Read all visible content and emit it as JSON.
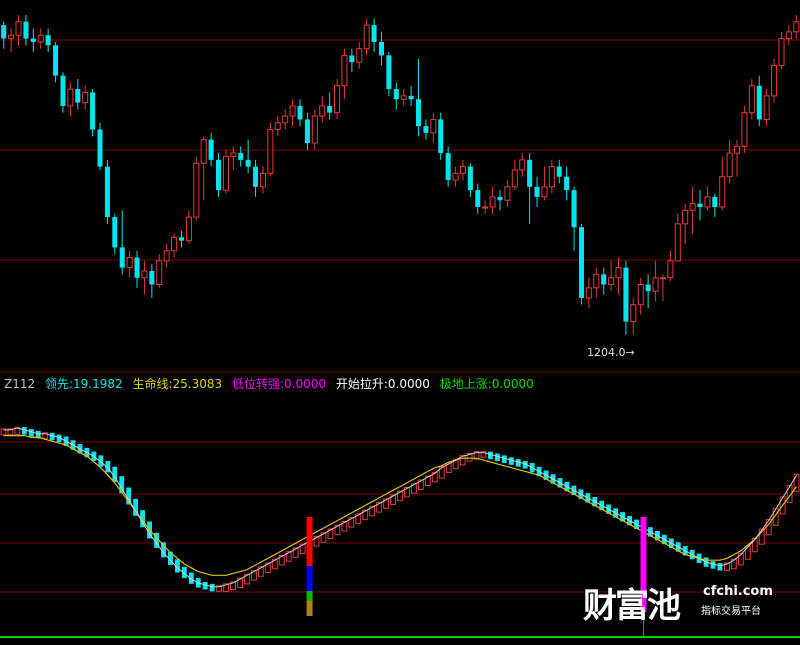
{
  "colors": {
    "background": "#000000",
    "up_candle": "#e8363a",
    "down_candle": "#00e5ee",
    "grid": "#7a0000",
    "yellow_line": "#d8c400",
    "white_line": "#d0d0d0",
    "bottom_line": "#00d000",
    "magenta_marker": "#ff00ff"
  },
  "legend": {
    "code": "Z112",
    "lead_label": "领先:19.1982",
    "life_label": "生命线:25.3083",
    "low_turn_label": "低位转强:0.0000",
    "start_rise_label": "开始拉升:0.0000",
    "bottom_rise_label": "极地上涨:0.0000",
    "code_color": "#c0c0c0",
    "lead_color": "#00e5ee",
    "life_color": "#e6d000",
    "low_turn_color": "#ff00ff",
    "start_rise_color": "#ffffff",
    "bottom_rise_color": "#00e000"
  },
  "price_annotation": "1204.0",
  "price_annotation_arrow": "→",
  "watermark": {
    "logo": "财富池",
    "site": "cfchi.com",
    "subtitle": "指标交易平台"
  },
  "chart_data": [
    {
      "type": "candlestick",
      "title": "",
      "note": "price panel; values in unscaled price units (no axis labels shown except the low annotation)",
      "min_price_label": 1204.0,
      "candles": [
        [
          100,
          96,
          101,
          93
        ],
        [
          96,
          97,
          99,
          92
        ],
        [
          97,
          101,
          103,
          94
        ],
        [
          101,
          96,
          103,
          94
        ],
        [
          96,
          95,
          99,
          92
        ],
        [
          95,
          97,
          99,
          93
        ],
        [
          97,
          94,
          99,
          92
        ],
        [
          94,
          85,
          95,
          83
        ],
        [
          85,
          76,
          86,
          74
        ],
        [
          76,
          81,
          83,
          73
        ],
        [
          81,
          77,
          84,
          75
        ],
        [
          77,
          80,
          82,
          75
        ],
        [
          80,
          69,
          81,
          67
        ],
        [
          69,
          58,
          71,
          57
        ],
        [
          58,
          43,
          60,
          41
        ],
        [
          43,
          34,
          44,
          32
        ],
        [
          34,
          28,
          45,
          26
        ],
        [
          28,
          31,
          33,
          25
        ],
        [
          31,
          25,
          33,
          22
        ],
        [
          25,
          27,
          30,
          20
        ],
        [
          27,
          23,
          29,
          19
        ],
        [
          23,
          30,
          32,
          22
        ],
        [
          30,
          33,
          35,
          28
        ],
        [
          33,
          37,
          38,
          31
        ],
        [
          37,
          36,
          39,
          34
        ],
        [
          36,
          43,
          45,
          35
        ],
        [
          43,
          59,
          61,
          42
        ],
        [
          59,
          66,
          67,
          48
        ],
        [
          66,
          60,
          68,
          58
        ],
        [
          60,
          51,
          62,
          49
        ],
        [
          51,
          61,
          63,
          50
        ],
        [
          61,
          62,
          64,
          57
        ],
        [
          62,
          60,
          64,
          58
        ],
        [
          60,
          58,
          66,
          56
        ],
        [
          58,
          52,
          60,
          49
        ],
        [
          52,
          56,
          58,
          50
        ],
        [
          56,
          69,
          71,
          55
        ],
        [
          69,
          71,
          73,
          67
        ],
        [
          71,
          73,
          75,
          69
        ],
        [
          73,
          76,
          78,
          70
        ],
        [
          76,
          72,
          78,
          70
        ],
        [
          72,
          65,
          74,
          63
        ],
        [
          65,
          73,
          75,
          63
        ],
        [
          73,
          76,
          79,
          71
        ],
        [
          76,
          74,
          80,
          72
        ],
        [
          74,
          82,
          84,
          72
        ],
        [
          82,
          91,
          93,
          78
        ],
        [
          91,
          89,
          93,
          86
        ],
        [
          89,
          93,
          95,
          87
        ],
        [
          93,
          100,
          102,
          91
        ],
        [
          100,
          95,
          102,
          92
        ],
        [
          95,
          91,
          98,
          88
        ],
        [
          91,
          81,
          92,
          79
        ],
        [
          81,
          78,
          83,
          75
        ],
        [
          78,
          79,
          81,
          76
        ],
        [
          79,
          78,
          82,
          76
        ],
        [
          78,
          70,
          90,
          67
        ],
        [
          70,
          68,
          72,
          66
        ],
        [
          68,
          72,
          74,
          65
        ],
        [
          72,
          62,
          74,
          60
        ],
        [
          62,
          54,
          64,
          52
        ],
        [
          54,
          56,
          58,
          52
        ],
        [
          56,
          58,
          60,
          54
        ],
        [
          58,
          51,
          59,
          49
        ],
        [
          51,
          46,
          53,
          44
        ],
        [
          46,
          46,
          48,
          44
        ],
        [
          46,
          49,
          52,
          44
        ],
        [
          49,
          48,
          51,
          45
        ],
        [
          48,
          52,
          54,
          46
        ],
        [
          52,
          57,
          60,
          51
        ],
        [
          57,
          60,
          62,
          55
        ],
        [
          60,
          52,
          62,
          41
        ],
        [
          52,
          49,
          55,
          46
        ],
        [
          49,
          52,
          58,
          48
        ],
        [
          52,
          58,
          60,
          50
        ],
        [
          58,
          55,
          60,
          53
        ],
        [
          55,
          51,
          58,
          48
        ],
        [
          51,
          40,
          52,
          33
        ],
        [
          40,
          19,
          41,
          17
        ],
        [
          19,
          22,
          25,
          16
        ],
        [
          22,
          26,
          28,
          19
        ],
        [
          26,
          23,
          28,
          20
        ],
        [
          23,
          25,
          30,
          21
        ],
        [
          25,
          28,
          31,
          20
        ],
        [
          28,
          12,
          30,
          8
        ],
        [
          12,
          17,
          19,
          8
        ],
        [
          17,
          23,
          25,
          14
        ],
        [
          23,
          21,
          26,
          16
        ],
        [
          21,
          25,
          30,
          18
        ],
        [
          25,
          25,
          26,
          18
        ],
        [
          25,
          30,
          33,
          24
        ],
        [
          30,
          41,
          44,
          30
        ],
        [
          41,
          45,
          47,
          35
        ],
        [
          45,
          47,
          52,
          38
        ],
        [
          47,
          46,
          51,
          42
        ],
        [
          46,
          49,
          52,
          45
        ],
        [
          49,
          46,
          50,
          43
        ],
        [
          46,
          55,
          61,
          45
        ],
        [
          55,
          62,
          66,
          53
        ],
        [
          62,
          64,
          66,
          55
        ],
        [
          64,
          74,
          76,
          62
        ],
        [
          74,
          82,
          84,
          72
        ],
        [
          82,
          72,
          85,
          70
        ],
        [
          72,
          79,
          81,
          70
        ],
        [
          79,
          88,
          90,
          77
        ],
        [
          88,
          96,
          98,
          87
        ],
        [
          96,
          98,
          100,
          94
        ],
        [
          98,
          101,
          103,
          96
        ]
      ]
    },
    {
      "type": "line",
      "title": "Z112",
      "note": "indicator panel with colored bars; values in unscaled indicator units",
      "series": [
        {
          "name": "领先",
          "values": [
            98,
            98,
            99,
            98,
            97,
            96,
            96,
            95,
            94,
            92,
            90,
            88,
            86,
            84,
            81,
            78,
            73,
            67,
            61,
            55,
            49,
            43,
            38,
            33,
            29,
            25,
            22,
            19,
            17,
            16,
            15,
            15,
            16,
            17,
            19,
            21,
            23,
            25,
            27,
            29,
            31,
            33,
            35,
            37,
            39,
            41,
            43,
            45,
            47,
            49,
            51,
            53,
            55,
            57,
            59,
            61,
            63,
            65,
            67,
            69,
            71,
            73,
            75,
            78,
            80,
            82,
            84,
            85,
            86,
            86,
            85,
            84,
            83,
            82,
            81,
            80,
            78,
            76,
            74,
            72,
            70,
            68,
            66,
            64,
            62,
            60,
            58,
            56,
            54,
            52,
            50,
            48,
            46,
            44,
            42,
            40,
            38,
            36,
            34,
            32,
            30,
            28,
            27,
            26,
            27,
            29,
            32,
            36,
            40,
            45,
            50,
            56,
            62,
            68,
            74
          ]
        },
        {
          "name": "生命线",
          "values": [
            96,
            96,
            96,
            96,
            95,
            95,
            94,
            93,
            92,
            91,
            89,
            87,
            85,
            82,
            79,
            75,
            71,
            66,
            61,
            56,
            51,
            46,
            42,
            38,
            34,
            31,
            28,
            26,
            24,
            23,
            22,
            22,
            22,
            23,
            24,
            25,
            27,
            29,
            31,
            33,
            35,
            37,
            39,
            41,
            43,
            45,
            47,
            49,
            51,
            53,
            55,
            57,
            59,
            61,
            63,
            65,
            67,
            69,
            71,
            73,
            75,
            77,
            79,
            80,
            82,
            83,
            84,
            84,
            84,
            83,
            82,
            81,
            80,
            79,
            78,
            77,
            76,
            75,
            73,
            71,
            69,
            67,
            65,
            63,
            61,
            59,
            57,
            55,
            53,
            51,
            49,
            47,
            45,
            43,
            41,
            39,
            37,
            35,
            33,
            32,
            31,
            30,
            30,
            30,
            31,
            33,
            35,
            38,
            41,
            45,
            49,
            54,
            59,
            64,
            69
          ]
        }
      ],
      "markers": [
        {
          "index": 44,
          "label": "color bar",
          "colors": [
            "#ff0000",
            "#0000ff",
            "#00c000",
            "#b08020"
          ]
        },
        {
          "index": 92,
          "label": "magenta bar",
          "colors": [
            "#ff00ff"
          ]
        }
      ]
    }
  ]
}
